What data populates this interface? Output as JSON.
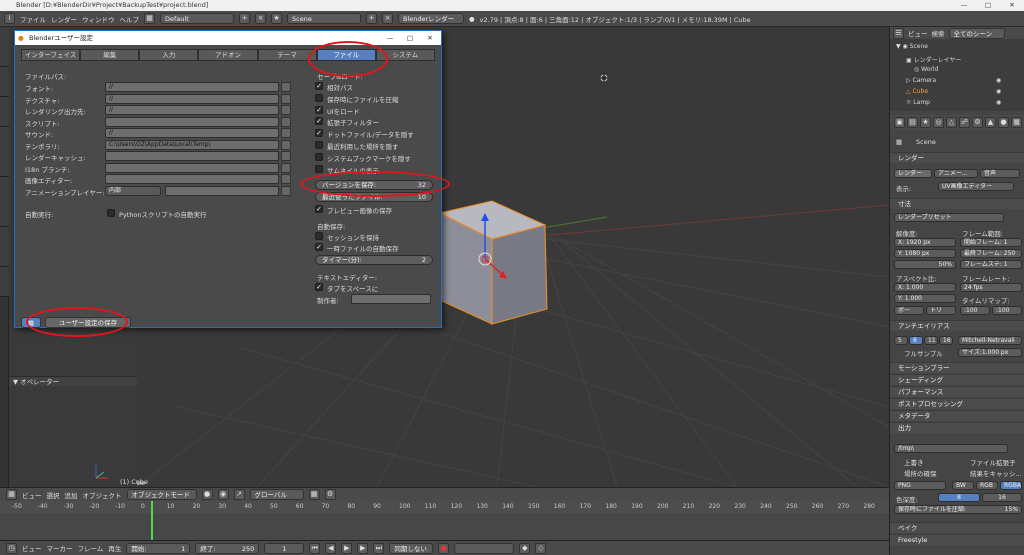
{
  "titlebar": {
    "text": "Blender [D:¥BlenderDir¥Project¥BackupTest¥project.blend]"
  },
  "infobar": {
    "menus": [
      "ファイル",
      "レンダー",
      "ウィンドウ",
      "ヘルプ"
    ],
    "layout": "Default",
    "scene": "Scene",
    "engine": "Blenderレンダー",
    "stats": "v2.79 | 頂点:8 | 面:6 | 三角面:12 | オブジェクト:1/3 | ランプ:0/1 | メモリ:18.39M | Cube"
  },
  "prefs": {
    "title": "Blenderユーザー設定",
    "tabs": [
      "インターフェイス",
      "編集",
      "入力",
      "アドオン",
      "テーマ",
      "ファイル",
      "システム"
    ],
    "active_tab": "ファイル",
    "section_paths": "ファイルパス:",
    "path_rows": [
      {
        "label": "フォント:",
        "value": "//"
      },
      {
        "label": "テクスチャ:",
        "value": "//"
      },
      {
        "label": "レンダリング出力先:",
        "value": "//"
      },
      {
        "label": "スクリプト:",
        "value": ""
      },
      {
        "label": "サウンド:",
        "value": "//"
      },
      {
        "label": "テンポラリ:",
        "value": "C:\\Users\\OZ\\AppData\\Local\\Temp\\"
      },
      {
        "label": "レンダーキャッシュ:",
        "value": ""
      },
      {
        "label": "I18n ブランチ:",
        "value": ""
      },
      {
        "label": "画像エディター:",
        "value": ""
      }
    ],
    "anim_player_label": "アニメーションプレイヤー:",
    "anim_player_value": "内部",
    "autoexec_label": "自動実行:",
    "autoexec_check": "Pythonスクリプトの自動実行",
    "save_load_label": "セーブ&ロード:",
    "save_load": [
      "相対パス",
      "保存時にファイルを圧縮",
      "UIをロード",
      "拡張子フィルター",
      "ドットファイル/データを隠す",
      "最近利用した場所を隠す",
      "システムブックマークを隠す",
      "サムネイルの表示"
    ],
    "save_versions_label": "バージョンを保存:",
    "save_versions_value": "32",
    "recent_files_label": "最近使ったファイル:",
    "recent_files_value": "10",
    "preview_save": "プレビュー画像の保存",
    "autosave_label": "自動保存:",
    "keep_session": "セッションを保持",
    "auto_temp": "一時ファイルの自動保存",
    "timer_label": "タイマー(分):",
    "timer_value": "2",
    "text_editor_label": "テキストエディター:",
    "tabs_as_spaces": "タブをスペースに",
    "author_label": "制作者:",
    "save_button": "ユーザー設定の保存"
  },
  "toolshelf": {
    "operator_label": "オペレーター"
  },
  "viewport": {
    "object_label": "(1) Cube"
  },
  "vp_header": {
    "menus": [
      "ビュー",
      "選択",
      "追加",
      "オブジェクト"
    ],
    "mode": "オブジェクトモード",
    "orientation": "グローバル"
  },
  "timeline": {
    "ticks": [
      "-50",
      "-40",
      "-30",
      "-20",
      "-10",
      "0",
      "10",
      "20",
      "30",
      "40",
      "50",
      "60",
      "70",
      "80",
      "90",
      "100",
      "110",
      "120",
      "130",
      "140",
      "150",
      "160",
      "170",
      "180",
      "190",
      "200",
      "210",
      "220",
      "230",
      "240",
      "250",
      "260",
      "270",
      "280"
    ],
    "menus": [
      "ビュー",
      "マーカー",
      "フレーム",
      "再生"
    ],
    "start_label": "開始:",
    "start_value": "1",
    "end_label": "終了:",
    "end_value": "250",
    "current": "1",
    "sync": "同期しない"
  },
  "outliner": {
    "tabs": [
      "ビュー",
      "検索",
      "全てのシーン"
    ],
    "rows": [
      "Scene",
      "レンダーレイヤー",
      "World",
      "Camera",
      "Cube",
      "Lamp"
    ]
  },
  "properties": {
    "scene_path": "Scene",
    "render_section": "レンダー",
    "render_btns": [
      "レンダー",
      "アニメー...",
      "音声"
    ],
    "display_label": "表示:",
    "display_value": "UV画像エディター",
    "dimensions_section": "寸法",
    "render_preset": "レンダープリセット",
    "resolution_label": "解像度:",
    "res_x": "X: 1920 px",
    "res_y": "Y: 1080 px",
    "res_pct": "50%",
    "frame_range_label": "フレーム範囲:",
    "start_frame": "開始フレーム: 1",
    "end_frame": "最終フレーム: 250",
    "frame_step": "フレームステ: 1",
    "aspect_label": "アスペクト比:",
    "asp_x": "X: 1.000",
    "asp_y": "Y: 1.000",
    "framerate_label": "フレームレート:",
    "framerate_value": "24 fps",
    "time_remap_label": "タイムリマップ:",
    "remap_old": ":100",
    "remap_new": ":100",
    "border_label": "ボー",
    "crop_label": "トリ",
    "aa_section": "アンチエイリアス",
    "aa_samples": [
      "5",
      "8",
      "11",
      "16"
    ],
    "aa_filter": "Mitchell-Netravali",
    "full_sample": "フルサンプル",
    "aa_size": "サイズ:1.000 px",
    "collapsed_sections": [
      "モーションブラー",
      "シェーディング",
      "パフォーマンス",
      "ポストプロセッシング",
      "メタデータ"
    ],
    "output_section": "出力",
    "output_path": "/tmp\\",
    "overwrite": "上書き",
    "file_ext": "ファイル拡張子",
    "placeholders": "場所の確保",
    "cache_result": "結果をキャッシ...",
    "format": "PNG",
    "bw": "BW",
    "rgb": "RGB",
    "rgba": "RGBA",
    "color_depth_label": "色深度:",
    "depth_8": "8",
    "depth_16": "16",
    "compress_label": "保存時にファイルを圧縮:",
    "compress_value": "15%",
    "bake_section": "ベイク",
    "freestyle": "Freestyle"
  },
  "colors": {
    "highlight_ring": "#e0161c",
    "active_tab": "#5680c2",
    "window_border": "#1a73c8"
  }
}
